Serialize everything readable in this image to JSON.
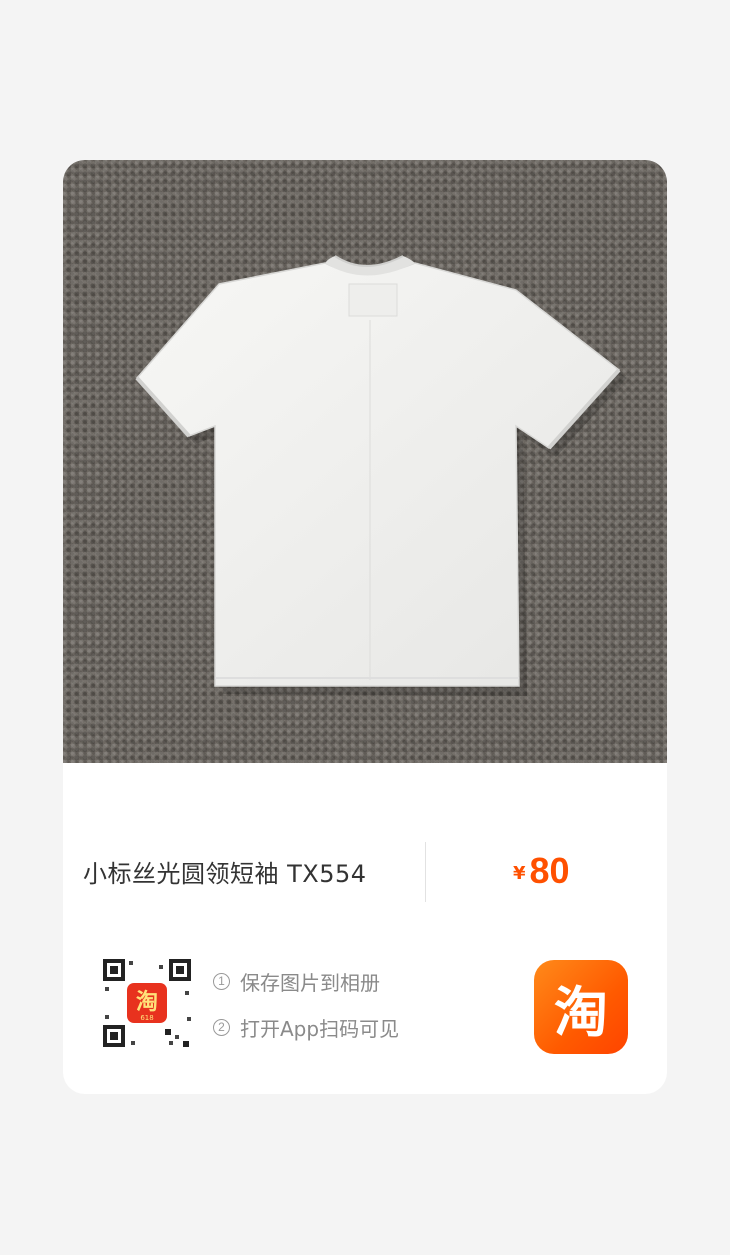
{
  "product": {
    "title": "小标丝光圆领短袖 TX554",
    "price_symbol": "¥",
    "price_value": "80"
  },
  "qr": {
    "app_badge_char": "淘",
    "app_badge_sub": "618"
  },
  "steps": [
    {
      "num": "1",
      "text": "保存图片到相册"
    },
    {
      "num": "2",
      "text": "打开App扫码可见"
    }
  ],
  "brand": {
    "logo_char": "淘",
    "color": "#ff5000"
  },
  "colors": {
    "price": "#ff5000",
    "background": "#f4f4f4",
    "card": "#ffffff"
  }
}
